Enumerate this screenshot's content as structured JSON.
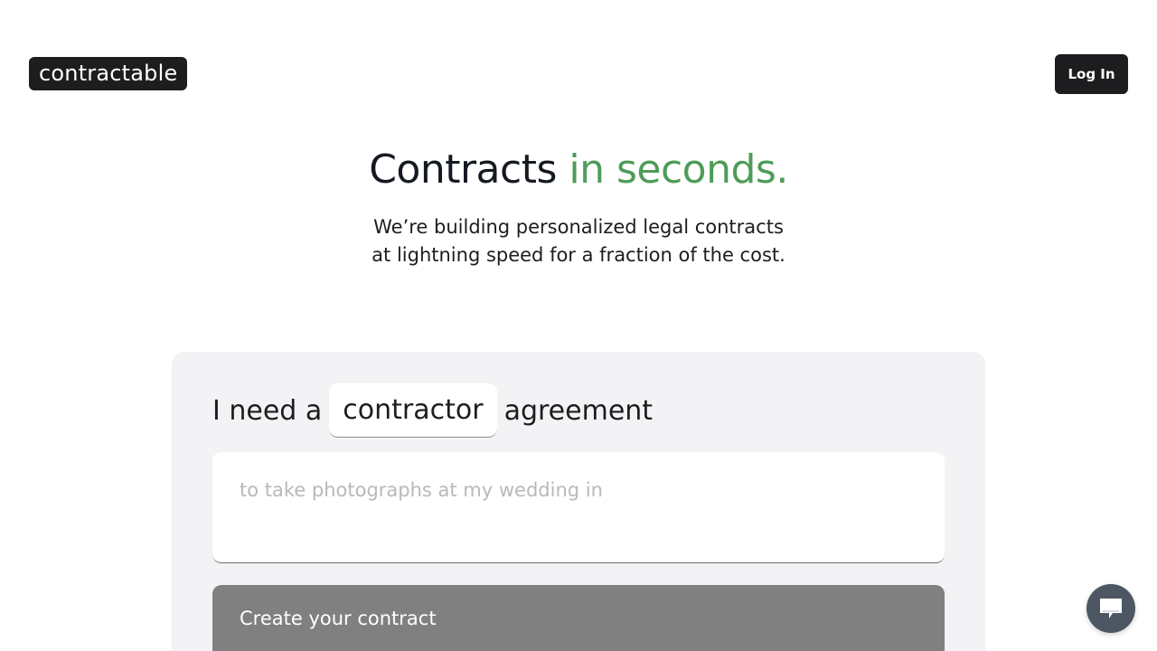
{
  "header": {
    "logo_text": "contractable",
    "login_label": "Log In"
  },
  "hero": {
    "title_main": "Contracts ",
    "title_accent": "in seconds.",
    "subtitle_line1": "We’re building personalized legal contracts",
    "subtitle_line2": "at lightning speed for a fraction of the cost."
  },
  "form": {
    "prefix": "I need a",
    "contract_type": "contractor",
    "suffix": "agreement",
    "details_placeholder": "to take photographs at my wedding in",
    "details_value": "",
    "submit_label": "Create your contract"
  },
  "colors": {
    "accent": "#4e9c58",
    "dark": "#1d1d1f",
    "card_bg": "#f3f3f6",
    "button_disabled": "#808080",
    "chat_bubble": "#4d5763"
  },
  "chat": {
    "icon": "chat-bubble-icon"
  }
}
